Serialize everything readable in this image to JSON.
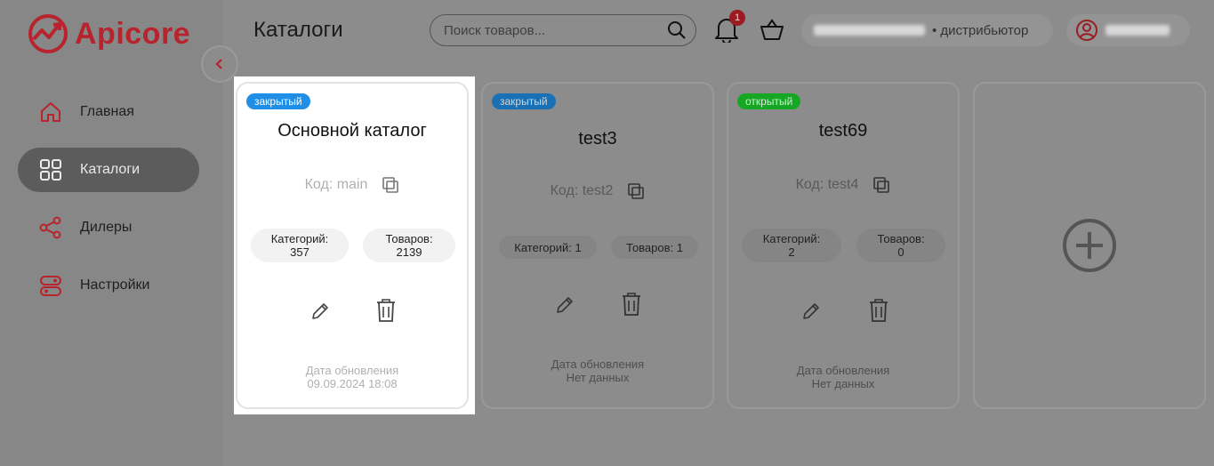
{
  "app": {
    "logo_text": "Apicore",
    "brand_color": "#b8232d"
  },
  "sidebar": {
    "items": [
      {
        "label": "Главная",
        "icon": "home-icon"
      },
      {
        "label": "Каталоги",
        "icon": "grid-icon",
        "active": true
      },
      {
        "label": "Дилеры",
        "icon": "share-icon"
      },
      {
        "label": "Настройки",
        "icon": "settings-icon"
      }
    ]
  },
  "header": {
    "title": "Каталоги",
    "search_placeholder": "Поиск товаров...",
    "notification_count": "1",
    "user_role": "• дистрибьютор"
  },
  "catalogs": [
    {
      "status": "закрытый",
      "title": "Основной каталог",
      "code": "Код: main",
      "categories_label": "Категорий:",
      "categories_value": "357",
      "products_label": "Товаров:",
      "products_value": "2139",
      "update_label": "Дата обновления",
      "update_value": "09.09.2024 18:08"
    },
    {
      "status": "закрытый",
      "title": "test3",
      "code": "Код: test2",
      "categories_text": "Категорий: 1",
      "products_text": "Товаров: 1",
      "update_label": "Дата обновления",
      "update_value": "Нет данных"
    },
    {
      "status": "открытый",
      "title": "test69",
      "code": "Код: test4",
      "categories_label": "Категорий:",
      "categories_value": "2",
      "products_label": "Товаров:",
      "products_value": "0",
      "update_label": "Дата обновления",
      "update_value": "Нет данных"
    }
  ]
}
